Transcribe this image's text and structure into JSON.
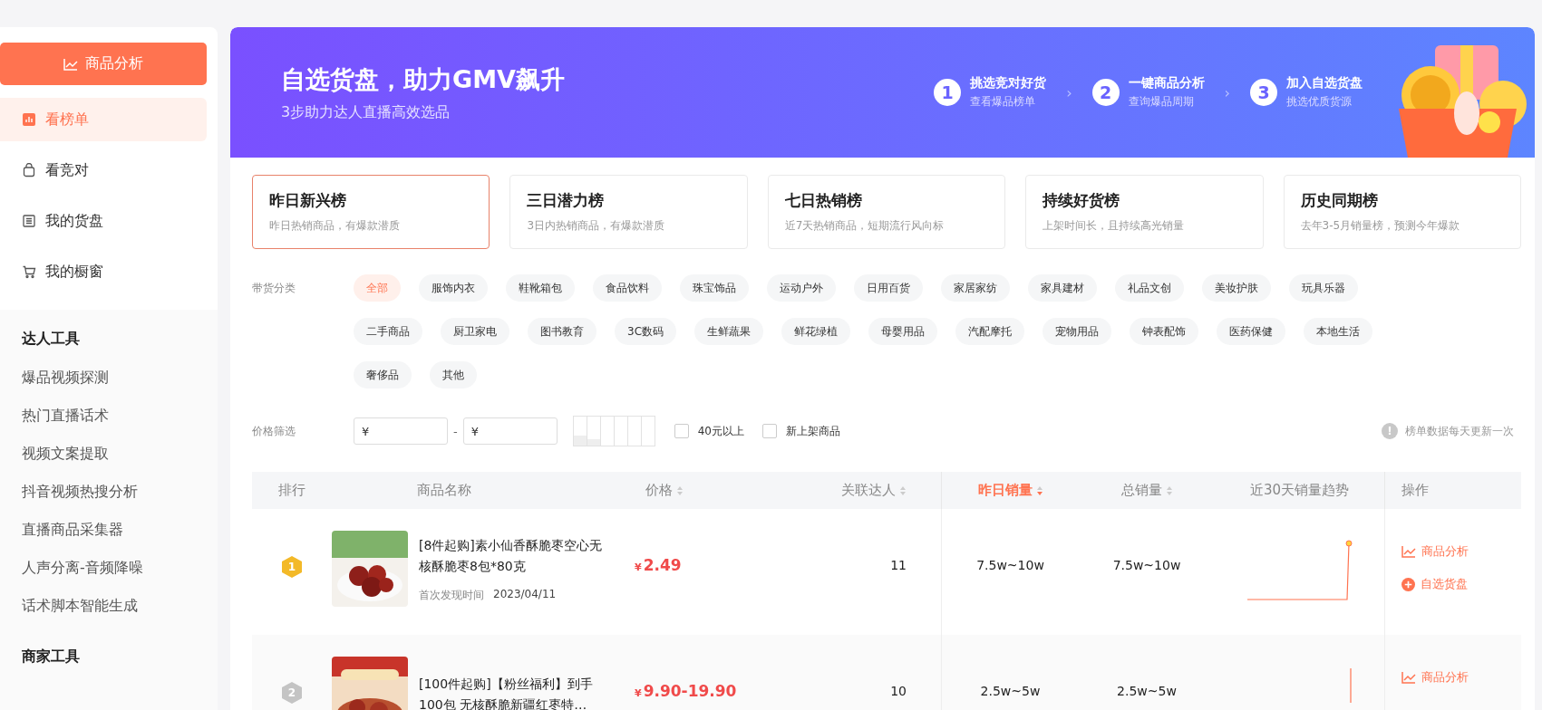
{
  "sidebar": {
    "primary_button": "商品分析",
    "nav": [
      {
        "label": "看榜单",
        "selected": true
      },
      {
        "label": "看竞对",
        "selected": false
      },
      {
        "label": "我的货盘",
        "selected": false
      },
      {
        "label": "我的橱窗",
        "selected": false
      }
    ],
    "sections": [
      {
        "title": "达人工具",
        "items": [
          "爆品视频探测",
          "热门直播话术",
          "视频文案提取",
          "抖音视频热搜分析",
          "直播商品采集器",
          "人声分离-音频降噪",
          "话术脚本智能生成"
        ]
      },
      {
        "title": "商家工具"
      }
    ]
  },
  "banner": {
    "title": "自选货盘，助力GMV飙升",
    "subtitle": "3步助力达人直播高效选品",
    "steps": [
      {
        "number": "1",
        "title": "挑选竞对好货",
        "subtitle": "查看爆品榜单"
      },
      {
        "number": "2",
        "title": "一键商品分析",
        "subtitle": "查询爆品周期"
      },
      {
        "number": "3",
        "title": "加入自选货盘",
        "subtitle": "挑选优质货源"
      }
    ],
    "separator": "›"
  },
  "rank_tabs": [
    {
      "title": "昨日新兴榜",
      "subtitle": "昨日热销商品，有爆款潜质",
      "selected": true
    },
    {
      "title": "三日潜力榜",
      "subtitle": "3日内热销商品，有爆款潜质",
      "selected": false
    },
    {
      "title": "七日热销榜",
      "subtitle": "近7天热销商品，短期流行风向标",
      "selected": false
    },
    {
      "title": "持续好货榜",
      "subtitle": "上架时间长，且持续高光销量",
      "selected": false
    },
    {
      "title": "历史同期榜",
      "subtitle": "去年3-5月销量榜，预测今年爆款",
      "selected": false
    }
  ],
  "category_filter": {
    "label": "带货分类",
    "chips": [
      {
        "label": "全部",
        "selected": true
      },
      {
        "label": "服饰内衣",
        "selected": false
      },
      {
        "label": "鞋靴箱包",
        "selected": false
      },
      {
        "label": "食品饮料",
        "selected": false
      },
      {
        "label": "珠宝饰品",
        "selected": false
      },
      {
        "label": "运动户外",
        "selected": false
      },
      {
        "label": "日用百货",
        "selected": false
      },
      {
        "label": "家居家纺",
        "selected": false
      },
      {
        "label": "家具建材",
        "selected": false
      },
      {
        "label": "礼品文创",
        "selected": false
      },
      {
        "label": "美妆护肤",
        "selected": false
      },
      {
        "label": "玩具乐器",
        "selected": false
      },
      {
        "label": "二手商品",
        "selected": false
      },
      {
        "label": "厨卫家电",
        "selected": false
      },
      {
        "label": "图书教育",
        "selected": false
      },
      {
        "label": "3C数码",
        "selected": false
      },
      {
        "label": "生鲜蔬果",
        "selected": false
      },
      {
        "label": "鲜花绿植",
        "selected": false
      },
      {
        "label": "母婴用品",
        "selected": false
      },
      {
        "label": "汽配摩托",
        "selected": false
      },
      {
        "label": "宠物用品",
        "selected": false
      },
      {
        "label": "钟表配饰",
        "selected": false
      },
      {
        "label": "医药保健",
        "selected": false
      },
      {
        "label": "本地生活",
        "selected": false
      },
      {
        "label": "奢侈品",
        "selected": false
      },
      {
        "label": "其他",
        "selected": false
      }
    ]
  },
  "price_filter": {
    "label": "价格筛选",
    "min_prefix": "¥",
    "dash": "-",
    "max_prefix": "¥",
    "checkboxes": [
      {
        "label": "40元以上",
        "checked": false
      },
      {
        "label": "新上架商品",
        "checked": false
      }
    ],
    "notice": "榜单数据每天更新一次",
    "notice_icon": "!"
  },
  "table": {
    "columns": [
      {
        "label": "排行",
        "kind": "plain",
        "selected": false
      },
      {
        "label": "商品名称",
        "kind": "plain",
        "selected": false
      },
      {
        "label": "价格",
        "kind": "sortable",
        "selected": false
      },
      {
        "label": "关联达人",
        "kind": "sortable",
        "selected": false
      },
      {
        "label": "昨日销量",
        "kind": "sorted",
        "selected": true
      },
      {
        "label": "总销量",
        "kind": "sortable",
        "selected": false
      },
      {
        "label": "近30天销量趋势",
        "kind": "plain",
        "selected": false
      },
      {
        "label": "操作",
        "kind": "plain",
        "selected": false
      }
    ],
    "rows": [
      {
        "rank": "1",
        "name": "[8件起购]素小仙香酥脆枣空心无核酥脆枣8包*80克",
        "first_seen_label": "首次发现时间",
        "first_seen": "2023/04/11",
        "price_symbol": "¥",
        "price": "2.49",
        "related": "11",
        "yesterday": "7.5w~10w",
        "total": "7.5w~10w",
        "actions": [
          {
            "kind": "analyze",
            "label": "商品分析"
          },
          {
            "kind": "add",
            "label": "自选货盘"
          }
        ]
      },
      {
        "rank": "2",
        "name": "[100件起购]【粉丝福利】到手100包 无核酥脆新疆红枣特…",
        "price_symbol": "¥",
        "price": "9.90-19.90",
        "related": "10",
        "yesterday": "2.5w~5w",
        "total": "2.5w~5w",
        "actions": [
          {
            "kind": "analyze",
            "label": "商品分析"
          }
        ]
      }
    ]
  }
}
